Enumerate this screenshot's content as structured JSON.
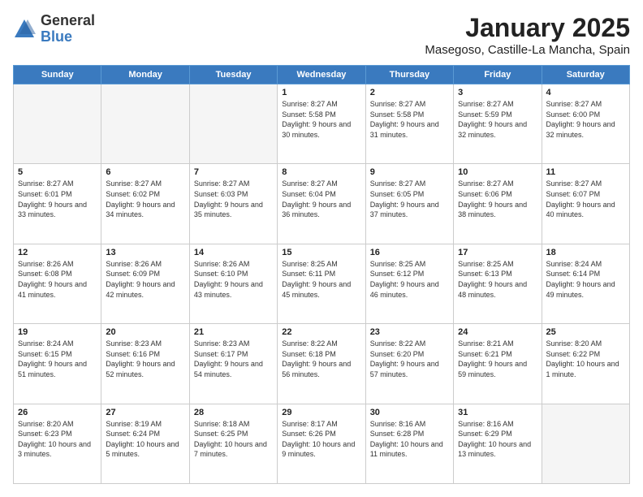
{
  "logo": {
    "general": "General",
    "blue": "Blue"
  },
  "header": {
    "month": "January 2025",
    "location": "Masegoso, Castille-La Mancha, Spain"
  },
  "weekdays": [
    "Sunday",
    "Monday",
    "Tuesday",
    "Wednesday",
    "Thursday",
    "Friday",
    "Saturday"
  ],
  "weeks": [
    [
      {
        "day": "",
        "info": ""
      },
      {
        "day": "",
        "info": ""
      },
      {
        "day": "",
        "info": ""
      },
      {
        "day": "1",
        "info": "Sunrise: 8:27 AM\nSunset: 5:58 PM\nDaylight: 9 hours and 30 minutes."
      },
      {
        "day": "2",
        "info": "Sunrise: 8:27 AM\nSunset: 5:58 PM\nDaylight: 9 hours and 31 minutes."
      },
      {
        "day": "3",
        "info": "Sunrise: 8:27 AM\nSunset: 5:59 PM\nDaylight: 9 hours and 32 minutes."
      },
      {
        "day": "4",
        "info": "Sunrise: 8:27 AM\nSunset: 6:00 PM\nDaylight: 9 hours and 32 minutes."
      }
    ],
    [
      {
        "day": "5",
        "info": "Sunrise: 8:27 AM\nSunset: 6:01 PM\nDaylight: 9 hours and 33 minutes."
      },
      {
        "day": "6",
        "info": "Sunrise: 8:27 AM\nSunset: 6:02 PM\nDaylight: 9 hours and 34 minutes."
      },
      {
        "day": "7",
        "info": "Sunrise: 8:27 AM\nSunset: 6:03 PM\nDaylight: 9 hours and 35 minutes."
      },
      {
        "day": "8",
        "info": "Sunrise: 8:27 AM\nSunset: 6:04 PM\nDaylight: 9 hours and 36 minutes."
      },
      {
        "day": "9",
        "info": "Sunrise: 8:27 AM\nSunset: 6:05 PM\nDaylight: 9 hours and 37 minutes."
      },
      {
        "day": "10",
        "info": "Sunrise: 8:27 AM\nSunset: 6:06 PM\nDaylight: 9 hours and 38 minutes."
      },
      {
        "day": "11",
        "info": "Sunrise: 8:27 AM\nSunset: 6:07 PM\nDaylight: 9 hours and 40 minutes."
      }
    ],
    [
      {
        "day": "12",
        "info": "Sunrise: 8:26 AM\nSunset: 6:08 PM\nDaylight: 9 hours and 41 minutes."
      },
      {
        "day": "13",
        "info": "Sunrise: 8:26 AM\nSunset: 6:09 PM\nDaylight: 9 hours and 42 minutes."
      },
      {
        "day": "14",
        "info": "Sunrise: 8:26 AM\nSunset: 6:10 PM\nDaylight: 9 hours and 43 minutes."
      },
      {
        "day": "15",
        "info": "Sunrise: 8:25 AM\nSunset: 6:11 PM\nDaylight: 9 hours and 45 minutes."
      },
      {
        "day": "16",
        "info": "Sunrise: 8:25 AM\nSunset: 6:12 PM\nDaylight: 9 hours and 46 minutes."
      },
      {
        "day": "17",
        "info": "Sunrise: 8:25 AM\nSunset: 6:13 PM\nDaylight: 9 hours and 48 minutes."
      },
      {
        "day": "18",
        "info": "Sunrise: 8:24 AM\nSunset: 6:14 PM\nDaylight: 9 hours and 49 minutes."
      }
    ],
    [
      {
        "day": "19",
        "info": "Sunrise: 8:24 AM\nSunset: 6:15 PM\nDaylight: 9 hours and 51 minutes."
      },
      {
        "day": "20",
        "info": "Sunrise: 8:23 AM\nSunset: 6:16 PM\nDaylight: 9 hours and 52 minutes."
      },
      {
        "day": "21",
        "info": "Sunrise: 8:23 AM\nSunset: 6:17 PM\nDaylight: 9 hours and 54 minutes."
      },
      {
        "day": "22",
        "info": "Sunrise: 8:22 AM\nSunset: 6:18 PM\nDaylight: 9 hours and 56 minutes."
      },
      {
        "day": "23",
        "info": "Sunrise: 8:22 AM\nSunset: 6:20 PM\nDaylight: 9 hours and 57 minutes."
      },
      {
        "day": "24",
        "info": "Sunrise: 8:21 AM\nSunset: 6:21 PM\nDaylight: 9 hours and 59 minutes."
      },
      {
        "day": "25",
        "info": "Sunrise: 8:20 AM\nSunset: 6:22 PM\nDaylight: 10 hours and 1 minute."
      }
    ],
    [
      {
        "day": "26",
        "info": "Sunrise: 8:20 AM\nSunset: 6:23 PM\nDaylight: 10 hours and 3 minutes."
      },
      {
        "day": "27",
        "info": "Sunrise: 8:19 AM\nSunset: 6:24 PM\nDaylight: 10 hours and 5 minutes."
      },
      {
        "day": "28",
        "info": "Sunrise: 8:18 AM\nSunset: 6:25 PM\nDaylight: 10 hours and 7 minutes."
      },
      {
        "day": "29",
        "info": "Sunrise: 8:17 AM\nSunset: 6:26 PM\nDaylight: 10 hours and 9 minutes."
      },
      {
        "day": "30",
        "info": "Sunrise: 8:16 AM\nSunset: 6:28 PM\nDaylight: 10 hours and 11 minutes."
      },
      {
        "day": "31",
        "info": "Sunrise: 8:16 AM\nSunset: 6:29 PM\nDaylight: 10 hours and 13 minutes."
      },
      {
        "day": "",
        "info": ""
      }
    ]
  ]
}
